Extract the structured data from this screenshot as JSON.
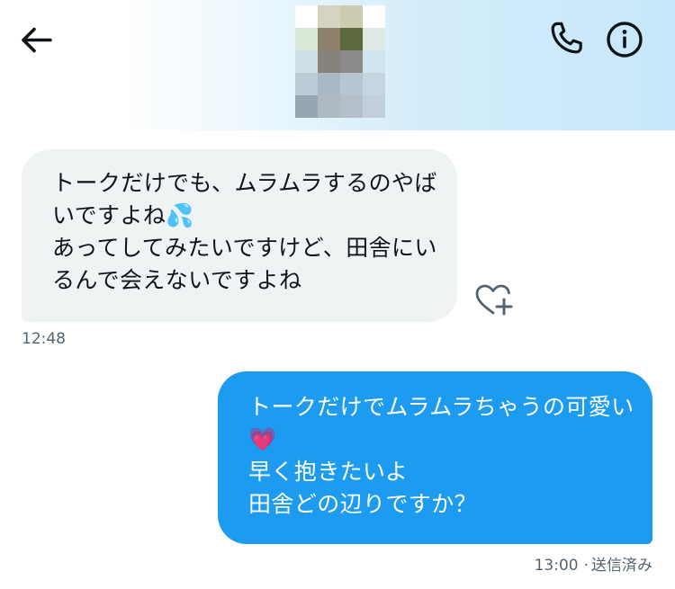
{
  "header": {
    "back_icon": "arrow-left-icon",
    "call_icon": "phone-icon",
    "info_icon": "info-circle-icon",
    "avatar_pixels": [
      "#ffffff",
      "#d6d3c0",
      "#ccccb0",
      "#ffffff",
      "#d9e7d6",
      "#8e826a",
      "#5d6a3e",
      "#dde9e5",
      "#cfe0e6",
      "#86827c",
      "#8b8a88",
      "#d0e4ee",
      "#bccbd6",
      "#a9b8c4",
      "#b7c5d0",
      "#c5d6e1",
      "#98a6b1",
      "#adbac4",
      "#b3c0ca",
      "#c1d0da"
    ]
  },
  "messages": [
    {
      "direction": "received",
      "text": "トークだけでも、ムラムラするのやばいですよね💦\nあってしてみたいですけど、田舎にいるんで会えないですよね",
      "time": "12:48",
      "reaction_icon": "heart-add-icon"
    },
    {
      "direction": "sent",
      "text": "トークだけでムラムラちゃうの可愛い💗\n早く抱きたいよ\n田舎どの辺りですか？",
      "time": "13:00",
      "separator": "·",
      "status": "送信済み"
    }
  ],
  "colors": {
    "sent_bubble": "#1d9bf0",
    "received_bubble": "#eff3f4",
    "timestamp": "#536471",
    "icon": "#0f1419"
  }
}
